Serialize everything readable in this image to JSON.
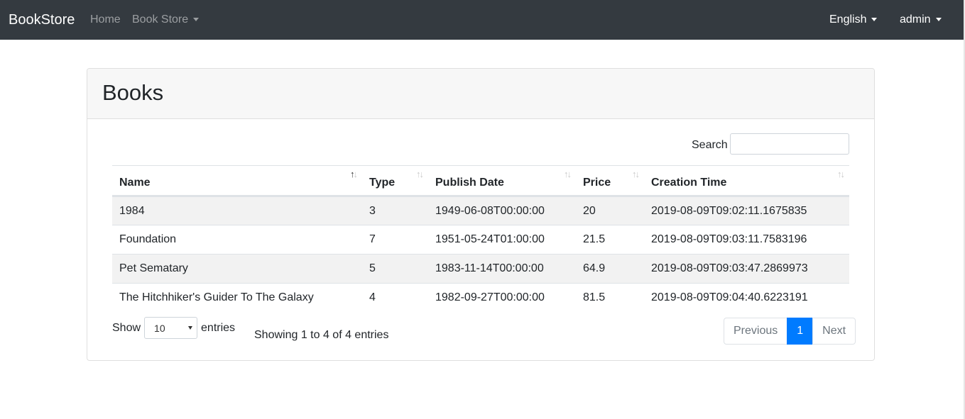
{
  "navbar": {
    "brand": "BookStore",
    "links": {
      "home": "Home",
      "book_store": "Book Store"
    },
    "language": "English",
    "user": "admin",
    "background": "#343a40"
  },
  "card": {
    "title": "Books"
  },
  "search": {
    "label": "Search",
    "value": ""
  },
  "table": {
    "columns": [
      "Name",
      "Type",
      "Publish Date",
      "Price",
      "Creation Time"
    ],
    "sort": {
      "column": "Name",
      "direction": "ascending"
    },
    "rows": [
      [
        "1984",
        "3",
        "1949-06-08T00:00:00",
        "20",
        "2019-08-09T09:02:11.1675835"
      ],
      [
        "Foundation",
        "7",
        "1951-05-24T01:00:00",
        "21.5",
        "2019-08-09T09:03:11.7583196"
      ],
      [
        "Pet Sematary",
        "5",
        "1983-11-14T00:00:00",
        "64.9",
        "2019-08-09T09:03:47.2869973"
      ],
      [
        "The Hitchhiker's Guider To The Galaxy",
        "4",
        "1982-09-27T00:00:00",
        "81.5",
        "2019-08-09T09:04:40.6223191"
      ]
    ]
  },
  "length": {
    "show": "Show",
    "value": "10",
    "entries": "entries"
  },
  "info": "Showing 1 to 4 of 4 entries",
  "pagination": {
    "previous": "Previous",
    "current": "1",
    "next": "Next",
    "accent": "#007bff"
  },
  "icons": {
    "caret": "caret-down-icon",
    "sort": "sort-arrows-icon"
  }
}
